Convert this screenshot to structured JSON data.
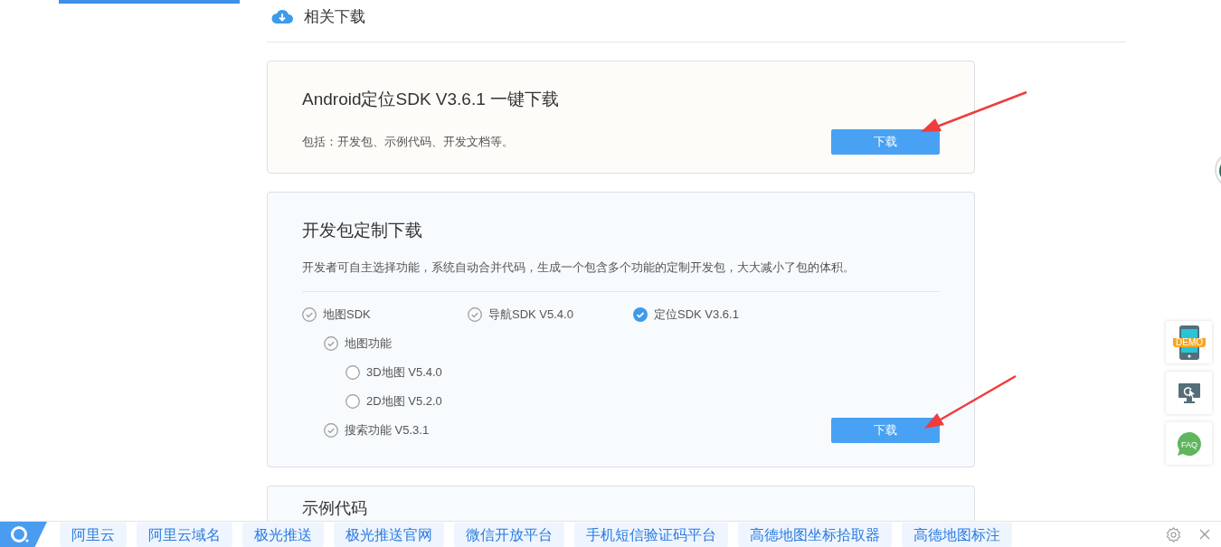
{
  "section_title": "相关下载",
  "cards": [
    {
      "kind": "simple",
      "title": "Android定位SDK V3.6.1 一键下载",
      "description": "包括：开发包、示例代码、开发文档等。",
      "button": "下载"
    },
    {
      "kind": "custom",
      "title": "开发包定制下载",
      "description": "开发者可自主选择功能，系统自动合并代码，生成一个包含多个功能的定制开发包，大大减小了包的体积。",
      "button": "下载",
      "options": [
        {
          "label": "地图SDK",
          "checked": true,
          "disabled": true,
          "children": [
            {
              "label": "地图功能",
              "checked": true,
              "disabled": true,
              "children": [
                {
                  "label": "3D地图 V5.4.0",
                  "checked": false,
                  "disabled": false
                },
                {
                  "label": "2D地图 V5.2.0",
                  "checked": false,
                  "disabled": false
                }
              ]
            },
            {
              "label": "搜索功能 V5.3.1",
              "checked": true,
              "disabled": true
            }
          ]
        },
        {
          "label": "导航SDK V5.4.0",
          "checked": true,
          "disabled": true
        },
        {
          "label": "定位SDK V3.6.1",
          "checked": true,
          "disabled": false
        }
      ]
    },
    {
      "kind": "partial",
      "title": "示例代码"
    }
  ],
  "side_tools": [
    {
      "kind": "demo",
      "label": "DEMO"
    },
    {
      "kind": "screen"
    },
    {
      "kind": "faq",
      "label": "FAQ"
    }
  ],
  "bottom_bar": {
    "links": [
      "阿里云",
      "阿里云域名",
      "极光推送",
      "极光推送官网",
      "微信开放平台",
      "手机短信验证码平台",
      "高德地图坐标拾取器",
      "高德地图标注"
    ]
  }
}
